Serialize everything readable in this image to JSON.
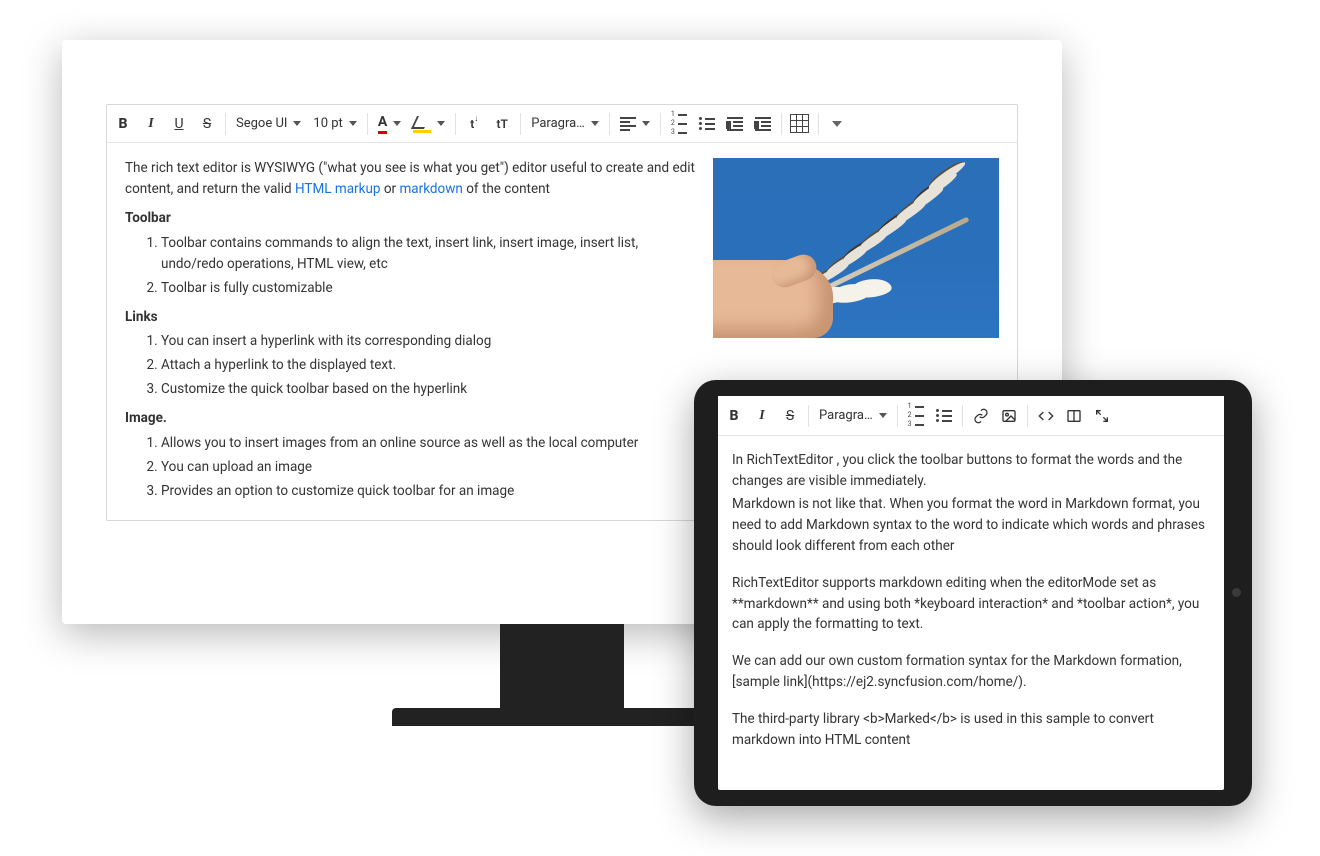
{
  "desktop": {
    "toolbar": {
      "bold": "B",
      "italic": "I",
      "underline": "U",
      "strike": "S",
      "font_family": "Segoe UI",
      "font_size": "10 pt",
      "font_color_letter": "A",
      "case_up": "t↑",
      "case_down": "tT",
      "paragraph": "Paragra…"
    },
    "content": {
      "intro_before": "The rich text editor is WYSIWYG (\"what you see is what you get\") editor useful to create and edit content, and return the valid ",
      "link1": "HTML markup",
      "intro_mid": " or ",
      "link2": "markdown",
      "intro_after": " of the content",
      "heading_toolbar": "Toolbar",
      "toolbar_items": [
        "Toolbar contains commands to align the text, insert link, insert image, insert list, undo/redo operations, HTML view, etc",
        "Toolbar is fully customizable"
      ],
      "heading_links": "Links",
      "links_items": [
        "You can insert a hyperlink with its corresponding dialog",
        "Attach a hyperlink to the displayed text.",
        "Customize the quick toolbar based on the hyperlink"
      ],
      "heading_image": "Image.",
      "image_items": [
        "Allows you to insert images from an online source as well as the local computer",
        "You can upload an image",
        "Provides an option to customize quick toolbar for an image"
      ]
    }
  },
  "tablet": {
    "toolbar": {
      "bold": "B",
      "italic": "I",
      "strike": "S",
      "paragraph": "Paragra…"
    },
    "content": {
      "p1": "In RichTextEditor , you click the toolbar buttons to format the words and the changes are visible immediately.",
      "p2": "Markdown is not like that. When you format the word in Markdown format, you need to add Markdown syntax to the word to indicate which words and phrases should look different from each other",
      "p3": "RichTextEditor supports markdown editing when the editorMode set as **markdown** and using both *keyboard interaction* and *toolbar action*, you can apply the formatting to text.",
      "p4": "We can add our own custom formation syntax for the Markdown formation, [sample link](https://ej2.syncfusion.com/home/).",
      "p5": "The third-party library <b>Marked</b> is used in this sample to convert markdown into HTML content"
    }
  }
}
